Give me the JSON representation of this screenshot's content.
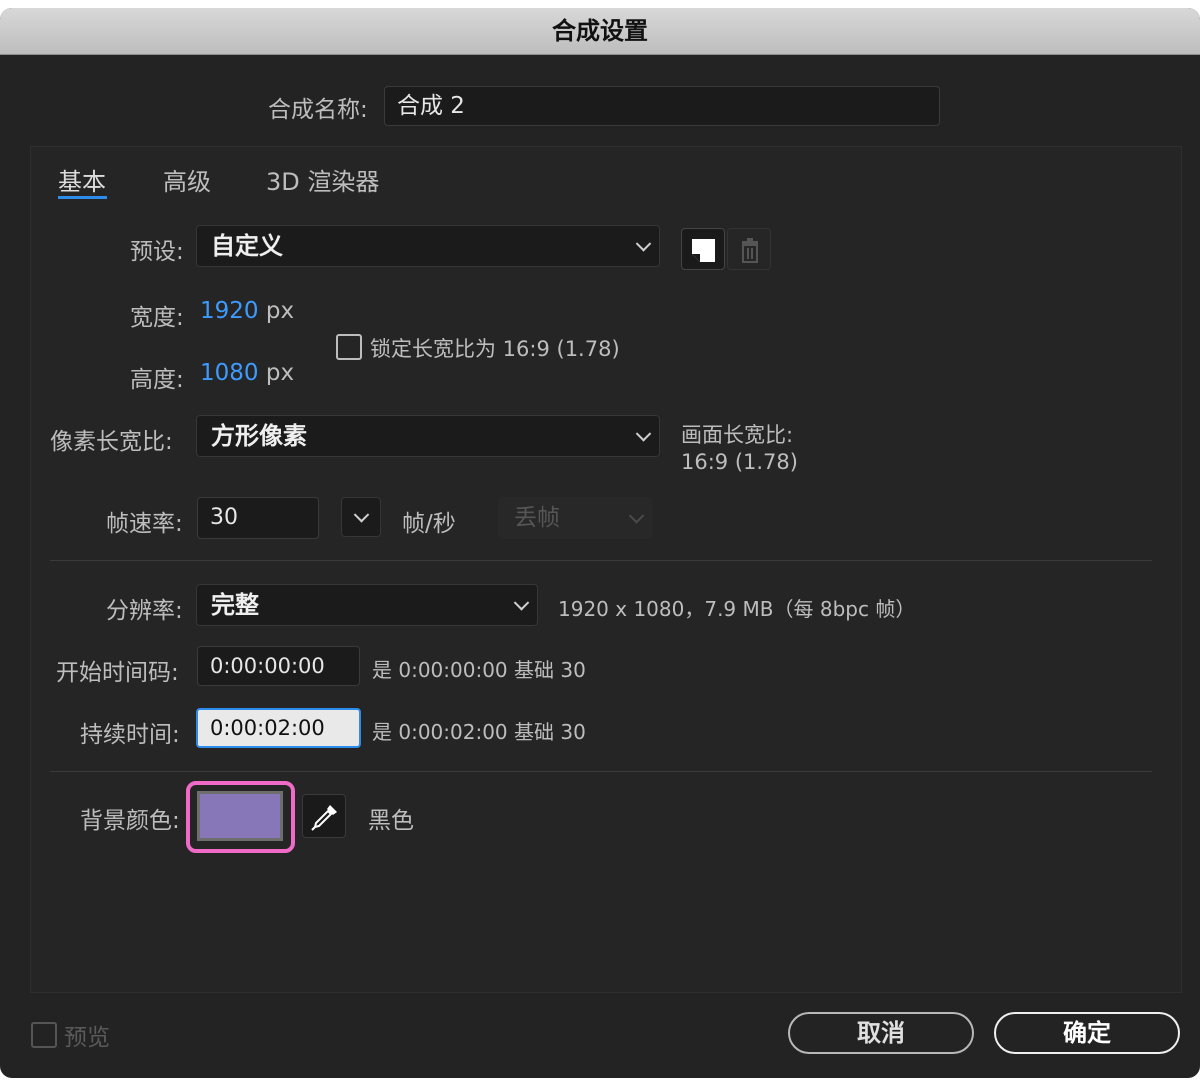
{
  "window": {
    "title": "合成设置"
  },
  "comp_name": {
    "label": "合成名称:",
    "value": "合成 2"
  },
  "tabs": [
    {
      "label": "基本"
    },
    {
      "label": "高级"
    },
    {
      "label": "3D 渲染器"
    }
  ],
  "preset": {
    "label": "预设:",
    "value": "自定义"
  },
  "width": {
    "label": "宽度:",
    "value": "1920",
    "unit": "px"
  },
  "height": {
    "label": "高度:",
    "value": "1080",
    "unit": "px"
  },
  "lock_aspect": {
    "label": "锁定长宽比为 16:9 (1.78)",
    "checked": false
  },
  "pixel_aspect": {
    "label": "像素长宽比:",
    "value": "方形像素"
  },
  "frame_aspect": {
    "label": "画面长宽比:",
    "value": "16:9 (1.78)"
  },
  "frame_rate": {
    "label": "帧速率:",
    "value": "30",
    "unit": "帧/秒",
    "drop_frame": "丢帧"
  },
  "resolution": {
    "label": "分辨率:",
    "value": "完整",
    "info": "1920 x 1080，7.9 MB（每 8bpc 帧）"
  },
  "start_timecode": {
    "label": "开始时间码:",
    "value": "0:00:00:00",
    "info": "是 0:00:00:00 基础 30"
  },
  "duration": {
    "label": "持续时间:",
    "value": "0:00:02:00",
    "info": "是 0:00:02:00 基础 30"
  },
  "background": {
    "label": "背景颜色:",
    "color": "#8776b8",
    "name": "黑色",
    "highlight": "#f06ac8"
  },
  "preview": {
    "label": "预览",
    "checked": false
  },
  "buttons": {
    "cancel": "取消",
    "ok": "确定"
  },
  "icons": [
    "new-preset-icon",
    "trash-icon",
    "eyedropper-icon",
    "chevron-down-icon"
  ]
}
